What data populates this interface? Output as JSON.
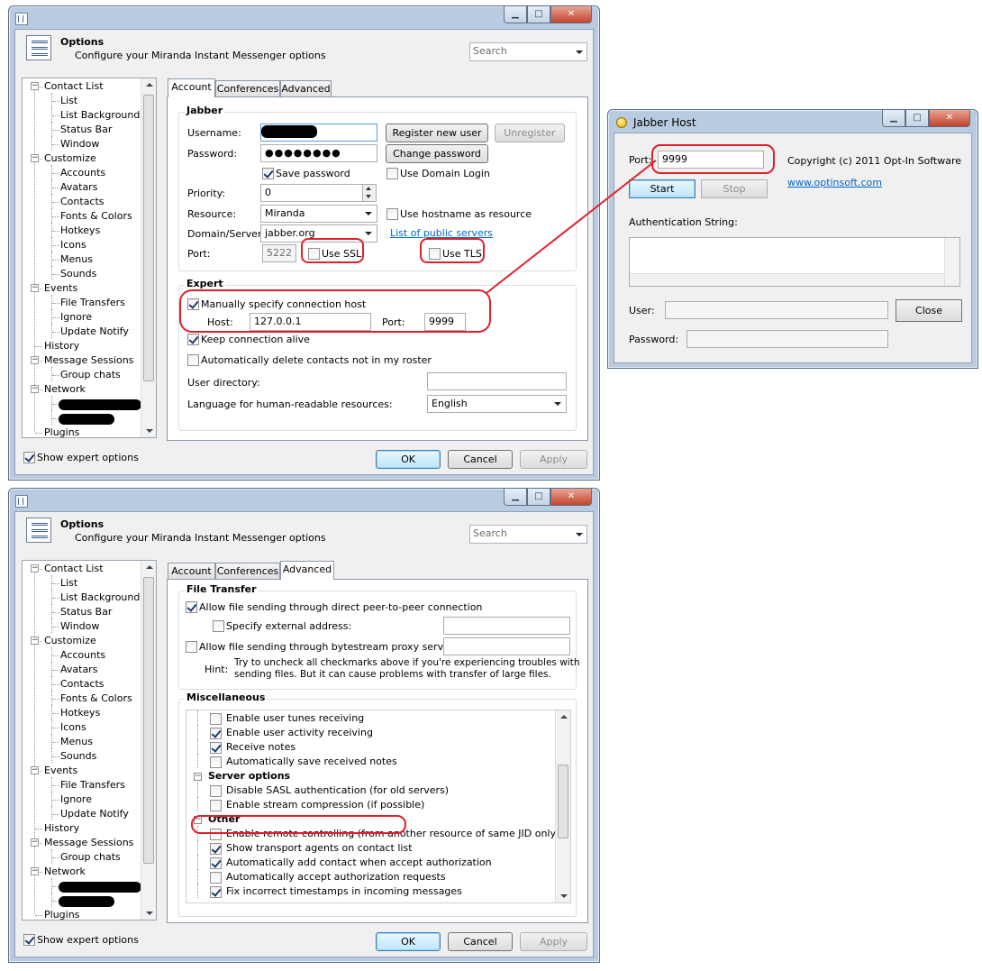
{
  "options_window": {
    "title": "Options",
    "subtitle": "Configure your Miranda Instant Messenger options",
    "search_placeholder": "Search",
    "tree": [
      {
        "label": "Contact List",
        "level": 0,
        "box": "−"
      },
      {
        "label": "List",
        "level": 1
      },
      {
        "label": "List Background",
        "level": 1
      },
      {
        "label": "Status Bar",
        "level": 1
      },
      {
        "label": "Window",
        "level": 1
      },
      {
        "label": "Customize",
        "level": 0,
        "box": "−"
      },
      {
        "label": "Accounts",
        "level": 1
      },
      {
        "label": "Avatars",
        "level": 1
      },
      {
        "label": "Contacts",
        "level": 1
      },
      {
        "label": "Fonts & Colors",
        "level": 1
      },
      {
        "label": "Hotkeys",
        "level": 1
      },
      {
        "label": "Icons",
        "level": 1
      },
      {
        "label": "Menus",
        "level": 1
      },
      {
        "label": "Sounds",
        "level": 1
      },
      {
        "label": "Events",
        "level": 0,
        "box": "−"
      },
      {
        "label": "File Transfers",
        "level": 1
      },
      {
        "label": "Ignore",
        "level": 1
      },
      {
        "label": "Update Notify",
        "level": 1
      },
      {
        "label": "History",
        "level": 0
      },
      {
        "label": "Message Sessions",
        "level": 0,
        "box": "−"
      },
      {
        "label": "Group chats",
        "level": 1
      },
      {
        "label": "Network",
        "level": 0,
        "box": "−"
      },
      {
        "label": "",
        "level": 1,
        "redacted": true
      },
      {
        "label": "",
        "level": 1,
        "redacted": true
      },
      {
        "label": "Plugins",
        "level": 0
      }
    ],
    "show_expert_label": "Show expert options",
    "buttons": {
      "ok": "OK",
      "cancel": "Cancel",
      "apply": "Apply"
    },
    "tabs": [
      "Account",
      "Conferences",
      "Advanced"
    ]
  },
  "account_tab": {
    "jabber_group": "Jabber",
    "username_label": "Username:",
    "password_label": "Password:",
    "password_value": "●●●●●●●●",
    "register_button": "Register new user",
    "unregister_button": "Unregister",
    "change_password_button": "Change password",
    "save_password_label": "Save password",
    "use_domain_login_label": "Use Domain Login",
    "priority_label": "Priority:",
    "priority_value": "0",
    "resource_label": "Resource:",
    "resource_value": "Miranda",
    "use_hostname_label": "Use hostname as resource",
    "domain_label": "Domain/Server:",
    "domain_value": "jabber.org",
    "public_servers_link": "List of public servers",
    "port_label": "Port:",
    "port_value": "5222",
    "use_ssl_label": "Use SSL",
    "use_tls_label": "Use TLS",
    "expert_group": "Expert",
    "manual_host_label": "Manually specify connection host",
    "host_label": "Host:",
    "host_value": "127.0.0.1",
    "host_port_label": "Port:",
    "host_port_value": "9999",
    "keep_alive_label": "Keep connection alive",
    "auto_delete_label": "Automatically delete contacts not in my roster",
    "user_directory_label": "User directory:",
    "language_label": "Language for human-readable resources:",
    "language_value": "English"
  },
  "advanced_tab": {
    "file_transfer_group": "File Transfer",
    "p2p_label": "Allow file sending through direct peer-to-peer connection",
    "external_address_label": "Specify external address:",
    "bytestream_label": "Allow file sending through bytestream proxy server:",
    "hint_label": "Hint:",
    "hint_text_1": "Try to uncheck all checkmarks above if you're experiencing troubles with",
    "hint_text_2": "sending files. But it can cause problems with transfer of large files.",
    "misc_group": "Miscellaneous",
    "misc_items": [
      {
        "label": "Enable user tunes receiving",
        "checked": false
      },
      {
        "label": "Enable user activity receiving",
        "checked": true
      },
      {
        "label": "Receive notes",
        "checked": true
      },
      {
        "label": "Automatically save received notes",
        "checked": false
      },
      {
        "label": "Server options",
        "header": true
      },
      {
        "label": "Disable SASL authentication (for old servers)",
        "checked": false
      },
      {
        "label": "Enable stream compression (if possible)",
        "checked": false
      },
      {
        "label": "Other",
        "header": true
      },
      {
        "label": "Enable remote controlling (from another resource of same JID only)",
        "checked": false
      },
      {
        "label": "Show transport agents on contact list",
        "checked": true
      },
      {
        "label": "Automatically add contact when accept authorization",
        "checked": true
      },
      {
        "label": "Automatically accept authorization requests",
        "checked": false
      },
      {
        "label": "Fix incorrect timestamps in incoming messages",
        "checked": true
      }
    ]
  },
  "jabber_host": {
    "title": "Jabber Host",
    "port_label": "Port:",
    "port_value": "9999",
    "copyright": "Copyright (c) 2011 Opt-In Software",
    "website": "www.optinsoft.com",
    "start_button": "Start",
    "stop_button": "Stop",
    "auth_label": "Authentication String:",
    "user_label": "User:",
    "password_label": "Password:",
    "close_button": "Close"
  },
  "colors": {
    "highlight": "#e0202a",
    "link": "#0066cc",
    "frame": "#b9cbe0"
  }
}
